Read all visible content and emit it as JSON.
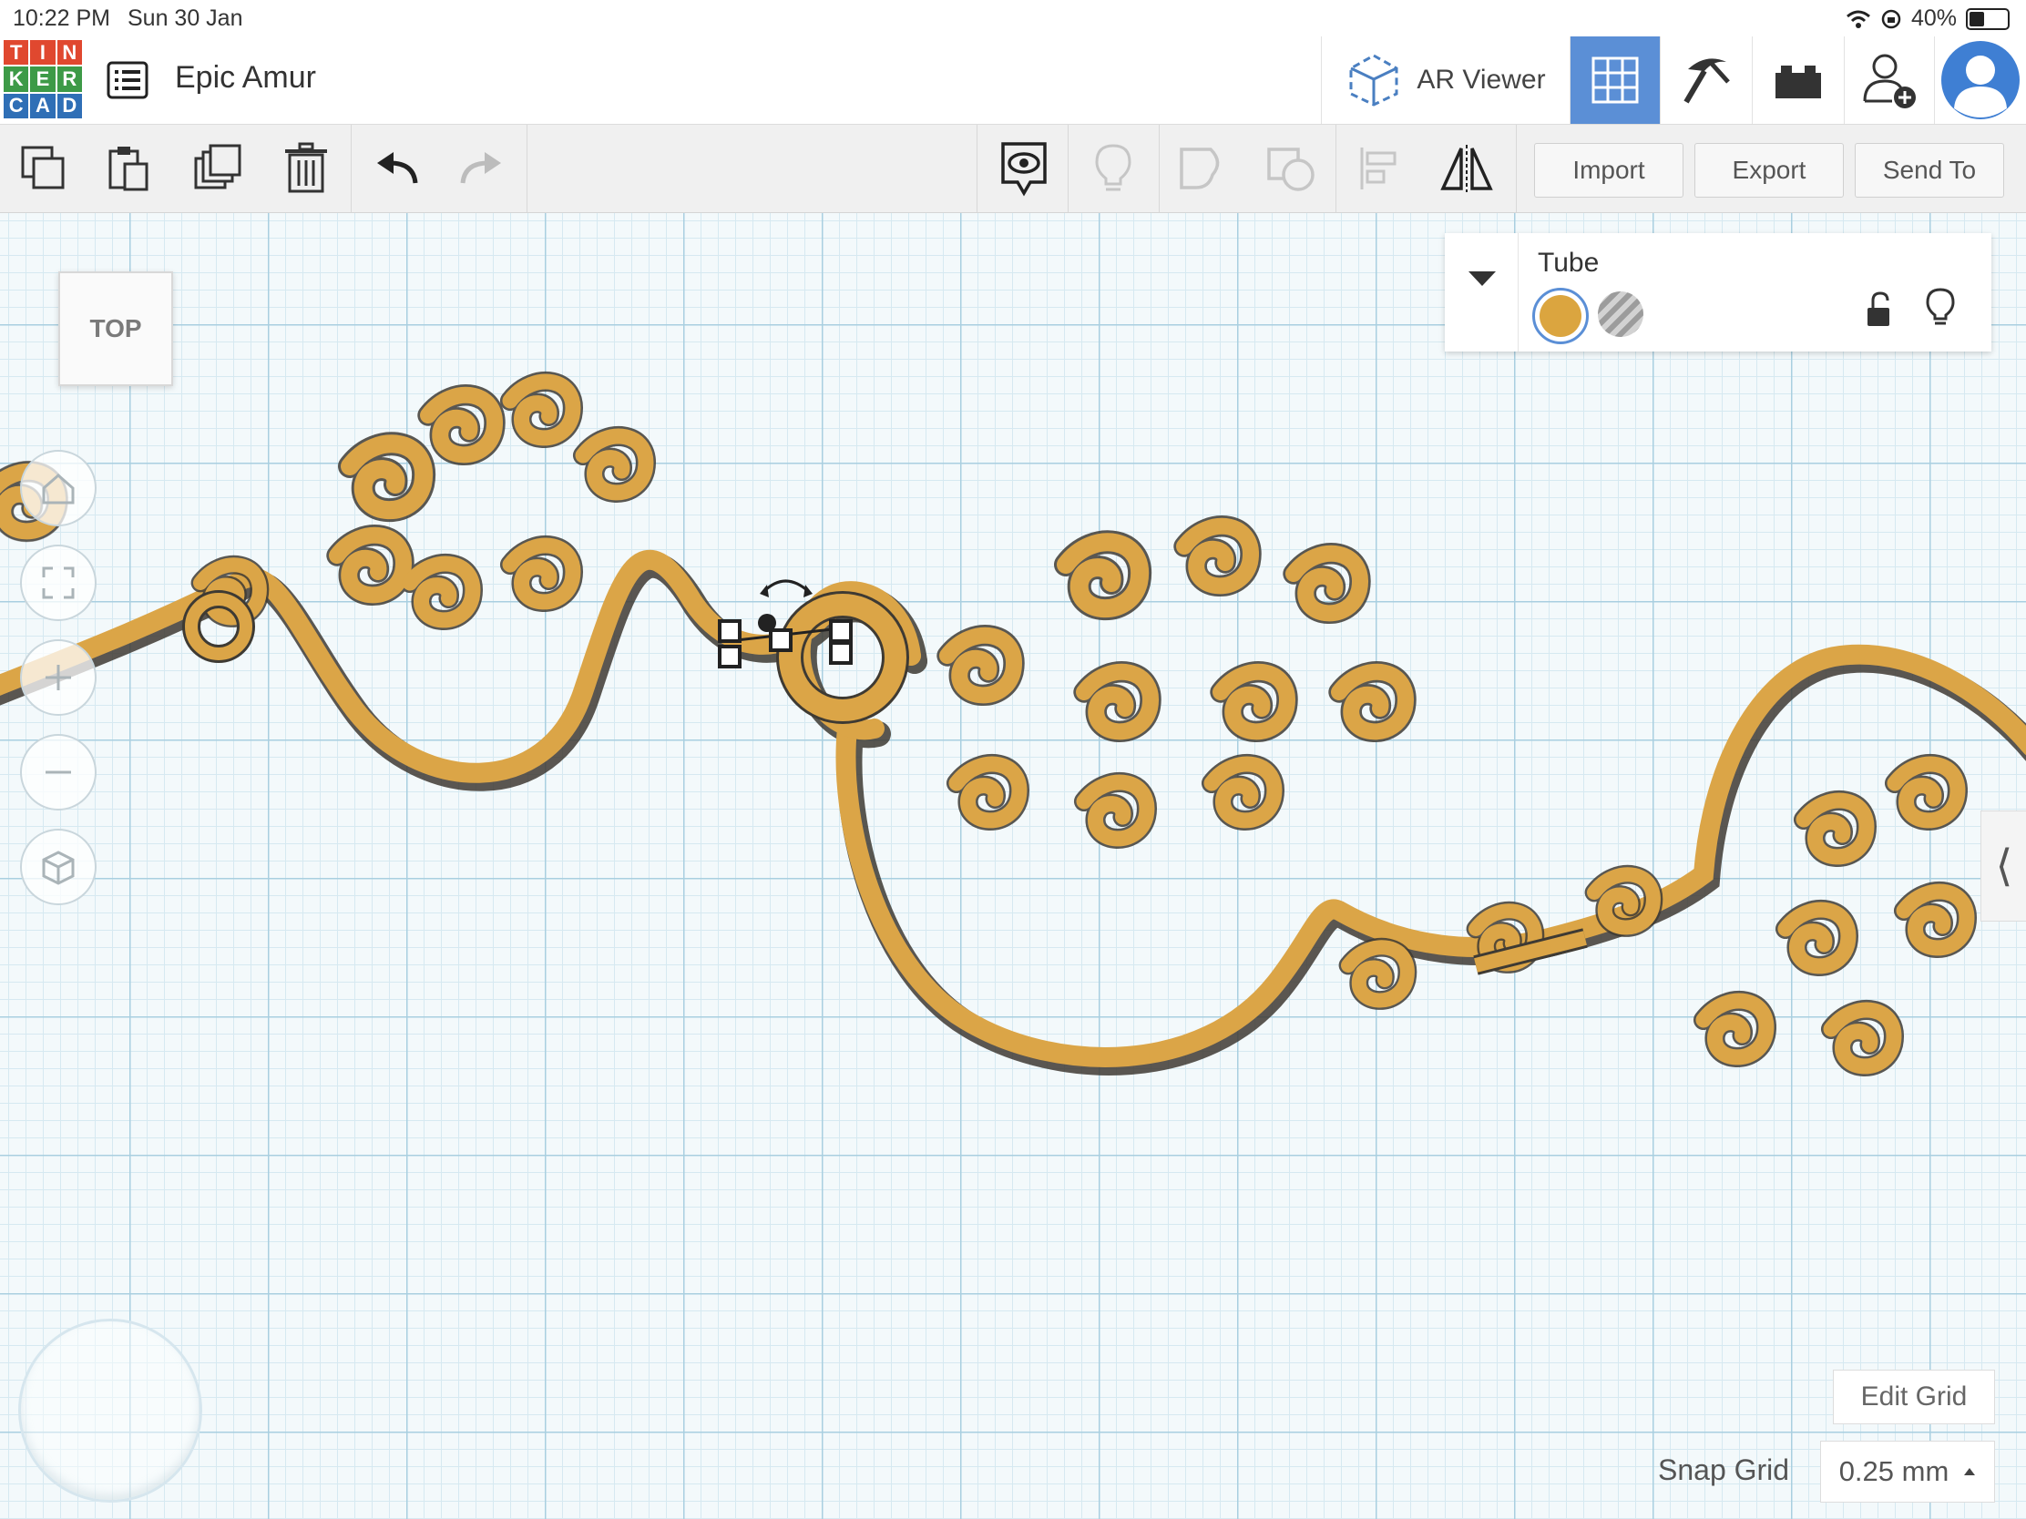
{
  "status_bar": {
    "time": "10:22 PM",
    "date": "Sun 30 Jan",
    "battery": "40%"
  },
  "header": {
    "logo_letters": [
      "T",
      "I",
      "N",
      "K",
      "E",
      "R",
      "C",
      "A",
      "D"
    ],
    "logo_colors": [
      "#e0482f",
      "#e0482f",
      "#e0482f",
      "#3d9a47",
      "#3d9a47",
      "#3d9a47",
      "#2f6fb6",
      "#2f6fb6",
      "#2f6fb6"
    ],
    "project_title": "Epic Amur",
    "ar_viewer_label": "AR Viewer"
  },
  "toolbar": {
    "import_label": "Import",
    "export_label": "Export",
    "send_to_label": "Send To"
  },
  "workplane": {
    "viewcube_label": "TOP",
    "shape_color": "#dba547"
  },
  "inspector": {
    "shape_name": "Tube",
    "solid_color": "#dba53f"
  },
  "grid": {
    "edit_grid_label": "Edit Grid",
    "snap_grid_label": "Snap Grid",
    "snap_grid_value": "0.25 mm"
  },
  "colors": {
    "accent": "#5b8fd6",
    "shape": "#dba547",
    "shape_edge": "#3e3a33"
  }
}
